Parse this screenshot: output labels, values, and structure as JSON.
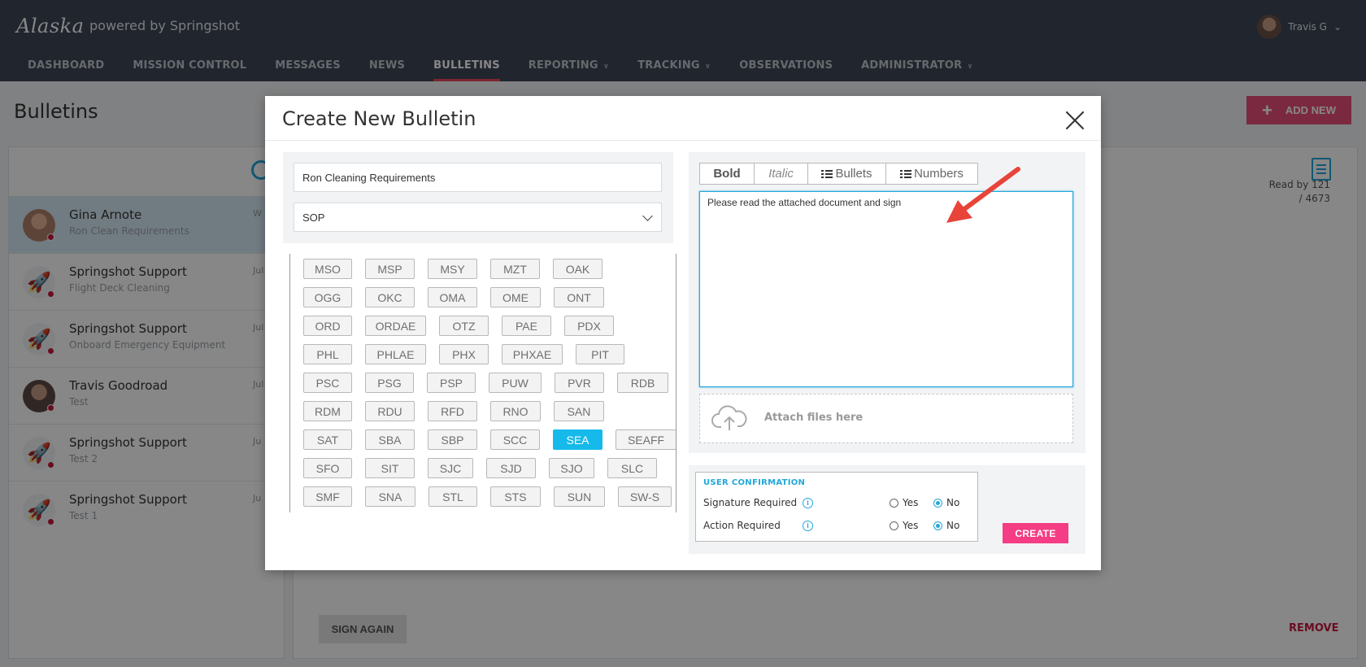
{
  "app": {
    "logo": "Alaska",
    "powered_by": "powered by Springshot",
    "user_name": "Travis G",
    "user_caret": "⌄"
  },
  "nav": [
    {
      "label": "DASHBOARD",
      "has_caret": false
    },
    {
      "label": "MISSION CONTROL",
      "has_caret": false
    },
    {
      "label": "MESSAGES",
      "has_caret": false
    },
    {
      "label": "NEWS",
      "has_caret": false
    },
    {
      "label": "BULLETINS",
      "has_caret": false,
      "active": true
    },
    {
      "label": "REPORTING",
      "has_caret": true
    },
    {
      "label": "TRACKING",
      "has_caret": true
    },
    {
      "label": "OBSERVATIONS",
      "has_caret": false
    },
    {
      "label": "ADMINISTRATOR",
      "has_caret": true
    }
  ],
  "page": {
    "title": "Bulletins",
    "add_new_plus": "+",
    "add_new_label": "ADD NEW",
    "read_by": "Read by 121 / 4673",
    "sign_again_label": "SIGN AGAIN",
    "remove_label": "REMOVE"
  },
  "bulletins": [
    {
      "name": "Gina Arnote",
      "subtitle": "Ron Clean Requirements",
      "date": "W",
      "avatar": "person",
      "selected": true
    },
    {
      "name": "Springshot Support",
      "subtitle": "Flight Deck Cleaning",
      "date": "Jul",
      "avatar": "rocket"
    },
    {
      "name": "Springshot Support",
      "subtitle": "Onboard Emergency Equipment",
      "date": "Jul",
      "avatar": "rocket"
    },
    {
      "name": "Travis Goodroad",
      "subtitle": "Test",
      "date": "Jul",
      "avatar": "person2"
    },
    {
      "name": "Springshot Support",
      "subtitle": "Test 2",
      "date": "Ju",
      "avatar": "rocket"
    },
    {
      "name": "Springshot Support",
      "subtitle": "Test 1",
      "date": "Ju",
      "avatar": "rocket"
    }
  ],
  "modal": {
    "title": "Create New Bulletin",
    "title_value": "Ron Cleaning Requirements",
    "category_value": "SOP",
    "toolbar": {
      "bold": "Bold",
      "italic": "Italic",
      "bullets": "Bullets",
      "numbers": "Numbers"
    },
    "message_value": "Please read the attached document and sign",
    "attach_label": "Attach files here",
    "confirmation": {
      "title": "USER CONFIRMATION",
      "signature_label": "Signature Required",
      "action_label": "Action Required",
      "yes": "Yes",
      "no": "No",
      "info_glyph": "i",
      "signature_selected": "No",
      "action_selected": "No"
    },
    "create_label": "CREATE"
  },
  "station_codes": [
    [
      "MSO",
      "MSP",
      "MSY",
      "MZT",
      "OAK"
    ],
    [
      "OGG",
      "OKC",
      "OMA",
      "OME",
      "ONT"
    ],
    [
      "ORD",
      "ORDAE",
      "OTZ",
      "PAE",
      "PDX"
    ],
    [
      "PHL",
      "PHLAE",
      "PHX",
      "PHXAE",
      "PIT"
    ],
    [
      "PSC",
      "PSG",
      "PSP",
      "PUW",
      "PVR",
      "RDB"
    ],
    [
      "RDM",
      "RDU",
      "RFD",
      "RNO",
      "SAN"
    ],
    [
      "SAT",
      "SBA",
      "SBP",
      "SCC",
      "SEA",
      "SEAFF"
    ],
    [
      "SFO",
      "SIT",
      "SJC",
      "SJD",
      "SJO",
      "SLC"
    ],
    [
      "SMF",
      "SNA",
      "STL",
      "STS",
      "SUN",
      "SW-S"
    ]
  ],
  "selected_station": "SEA",
  "colors": {
    "topbar": "#3e4657",
    "accent_blue": "#22a7d9",
    "selected_chip": "#15b9ea",
    "create_pink": "#f43d84",
    "add_new_pink": "#e84f7a",
    "remove_red": "#c8183d",
    "annotation_arrow": "#e8443a"
  }
}
